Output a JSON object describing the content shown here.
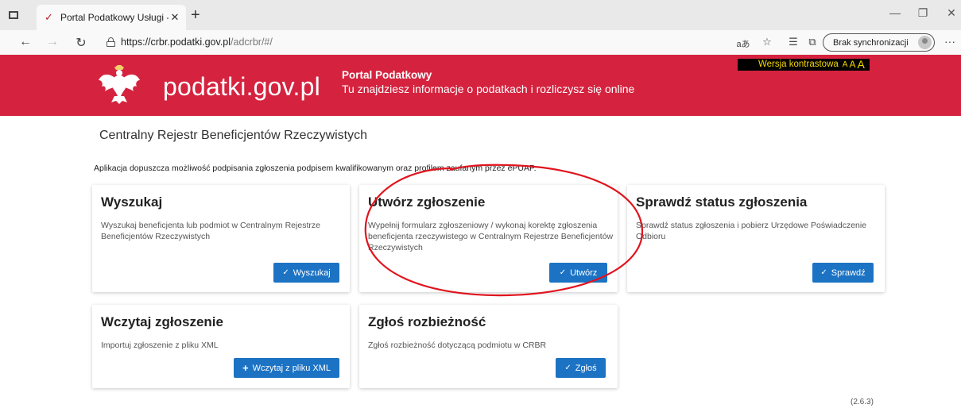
{
  "browser": {
    "tab_title": "Portal Podatkowy Usługi - ADCR",
    "url_host": "https://crbr.podatki.gov.pl",
    "url_path": "/adcrbr/#/",
    "sync_label": "Brak synchronizacji",
    "read_aloud": "aあ"
  },
  "header": {
    "brand": "podatki.gov.pl",
    "portal_title": "Portal Podatkowy",
    "portal_subtitle": "Tu znajdziesz informacje o podatkach i rozliczysz się online",
    "contrast_label": "Wersja kontrastowa",
    "font_sizes": [
      "A",
      "A",
      "A"
    ]
  },
  "main": {
    "title": "Centralny Rejestr Beneficjentów Rzeczywistych",
    "notice": "Aplikacja dopuszcza możliwość podpisania zgłoszenia podpisem kwalifikowanym oraz profilem zaufanym przez ePUAP.",
    "cards": [
      {
        "title": "Wyszukaj",
        "desc": "Wyszukaj beneficjenta lub podmiot w Centralnym Rejestrze Beneficjentów Rzeczywistych",
        "button": "Wyszukaj",
        "icon": "check-icon"
      },
      {
        "title": "Utwórz zgłoszenie",
        "desc": "Wypełnij formularz zgłoszeniowy / wykonaj korektę zgłoszenia beneficjenta rzeczywistego w Centralnym Rejestrze Beneficjentów Rzeczywistych",
        "button": "Utwórz",
        "icon": "check-icon"
      },
      {
        "title": "Sprawdź status zgłoszenia",
        "desc": "Sprawdź status zgłoszenia i pobierz Urzędowe Poświadczenie Odbioru",
        "button": "Sprawdź",
        "icon": "check-icon"
      },
      {
        "title": "Wczytaj zgłoszenie",
        "desc": "Importuj zgłoszenie z pliku XML",
        "button": "Wczytaj z pliku XML",
        "icon": "plus-icon"
      },
      {
        "title": "Zgłoś rozbieżność",
        "desc": "Zgłoś rozbieżność dotyczącą podmiotu w CRBR",
        "button": "Zgłoś",
        "icon": "check-icon"
      }
    ],
    "version": "(2.6.3)"
  },
  "colors": {
    "banner": "#d5233f",
    "button": "#1c73c4",
    "annotation": "#e0141e"
  }
}
